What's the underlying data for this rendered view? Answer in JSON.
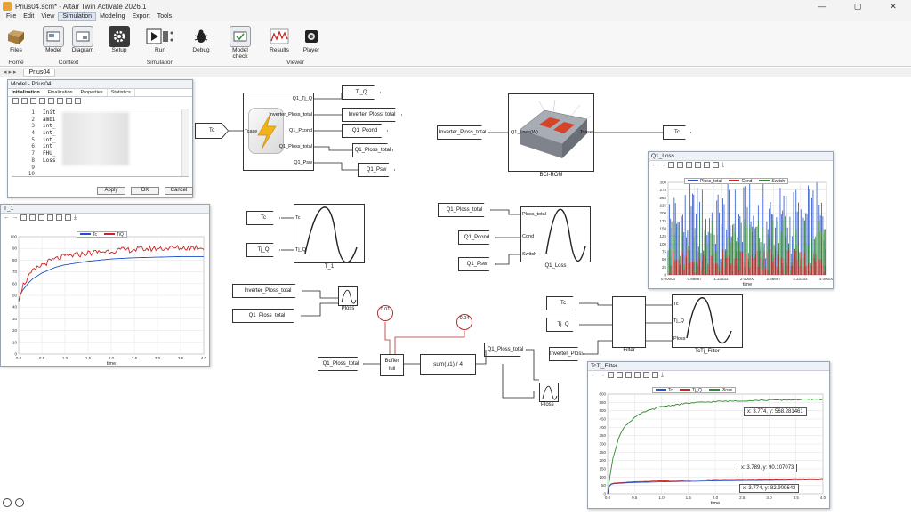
{
  "window": {
    "title": "Prius04.scm* - Altair Twin Activate 2026.1",
    "controls": [
      "—",
      "▢",
      "✕"
    ]
  },
  "menu": [
    "File",
    "Edit",
    "View",
    "Simulation",
    "Modeling",
    "Export",
    "Tools"
  ],
  "menu_active": "Simulation",
  "ribbon": {
    "buttons": {
      "files": "Files",
      "model": "Model",
      "diagram": "Diagram",
      "setup": "Setup",
      "run": "Run",
      "debug": "Debug",
      "model_check": "Model check",
      "results": "Results",
      "player": "Player"
    },
    "groups": {
      "home": "Home",
      "context": "Context",
      "simulation": "Simulation",
      "viewer": "Viewer"
    }
  },
  "breadcrumb": {
    "nav": "◂ ▸ ▸",
    "tab": "Prius04"
  },
  "model_dialog": {
    "title": "Model - Prius04",
    "tabs": [
      "Initialization",
      "Finalization",
      "Properties",
      "Statistics"
    ],
    "line_numbers": [
      "1",
      "2",
      "3",
      "4",
      "5",
      "6",
      "7",
      "8",
      "9",
      "10"
    ],
    "code": [
      "Init",
      "ambi",
      "int_",
      "int_",
      "int_",
      "int_",
      "FHU_",
      "Loss",
      "",
      ""
    ],
    "buttons": {
      "apply": "Apply",
      "ok": "OK",
      "cancel": "Cancel"
    }
  },
  "blocks": {
    "tc_in_1": "Tc",
    "tcase_port": "Tcase",
    "outs_1": {
      "tj_q": "Q1_Tj_Q",
      "inv_ploss": "Inverter_Ploss_total",
      "pcond": "Q1_Pcond",
      "ploss": "Q1_Ploss_total",
      "psw": "Q1_Psw"
    },
    "sigs_1": {
      "tj_q": "Tj_Q",
      "inv_ploss": "Inverter_Ploss_total",
      "pcond": "Q1_Pcond",
      "ploss": "Q1_Ploss_total",
      "psw": "Q1_Psw"
    },
    "bci": {
      "label": "BCI-ROM",
      "in_sig": "Inverter_Ploss_total",
      "in_port": "Q1_Loss(W)",
      "out_port": "Tcase",
      "out_sig": "Tc"
    },
    "t1": {
      "in_tc": "Tc",
      "in_tjq": "Tj_Q",
      "port_tc": "Tc",
      "port_tjq": "Tj_Q",
      "label": "T_1"
    },
    "q1loss": {
      "in_ploss": "Q1_Ploss_total",
      "in_pcond": "Q1_Pcond",
      "in_psw": "Q1_Psw",
      "port_ploss": "Ploss_total",
      "port_cond": "Cond",
      "port_switch": "Switch",
      "label": "Q1_Loss"
    },
    "ploss_scope": {
      "in_inv": "Inverter_Ploss_total",
      "in_q1": "Q1_Ploss_total",
      "label": "Ploss"
    },
    "const1": "0.01",
    "const2": "0.04",
    "buffer": {
      "in": "Q1_Ploss_total",
      "label": "Buffer",
      "sub": "full"
    },
    "sum": "sum(u1) / 4",
    "avg": {
      "sig": "Q1_Ploss_total",
      "label": "Ploss_"
    },
    "filter": {
      "in_tc": "Tc",
      "in_tjq": "Tj_Q",
      "in_inv": "Inverter_Ploss",
      "label": "Filter"
    },
    "tctj": {
      "port_tc": "Tc",
      "port_tjq": "Tj_Q",
      "port_ploss": "Ploss",
      "label": "TcTj_Filter"
    }
  },
  "panels": {
    "t1": {
      "title": "T_1",
      "legend": [
        "Tc",
        "TiQ"
      ],
      "colors": [
        "#1f4fc9",
        "#cc2222"
      ],
      "xlabel": "time"
    },
    "q1loss": {
      "title": "Q1_Loss",
      "legend": [
        "Ploss_total",
        "Cond",
        "Switch"
      ],
      "colors": [
        "#2a52c8",
        "#cc2222",
        "#2e8b2e"
      ],
      "xlabel": "time"
    },
    "tctj": {
      "title": "TcTj_Filter",
      "legend": [
        "Tc",
        "Tj_Q",
        "Ploss"
      ],
      "colors": [
        "#2a52c8",
        "#cc2222",
        "#2e8b2e"
      ],
      "xlabel": "time",
      "tooltips": [
        "x: 3.774,  y: 568.281461",
        "x: 3.789,  y: 90.107073",
        "x: 3.774,  y: 82.909643"
      ]
    }
  },
  "chart_data": [
    {
      "type": "line",
      "x_ticks": [
        "0.0",
        "0.5",
        "1.0",
        "1.5",
        "2.0",
        "2.5",
        "3.0",
        "3.5",
        "4.0"
      ],
      "y_ticks": [
        "0",
        "10",
        "20",
        "30",
        "40",
        "50",
        "60",
        "70",
        "80",
        "90",
        "100"
      ],
      "xlim": [
        0,
        4
      ],
      "ylim": [
        0,
        100
      ],
      "xlabel": "time",
      "series": [
        {
          "name": "Tc",
          "x": [
            0,
            0.05,
            0.1,
            0.2,
            0.3,
            0.5,
            0.8,
            1.0,
            1.5,
            2.0,
            2.5,
            3.0,
            3.5,
            4.0
          ],
          "values": [
            46,
            52,
            55,
            60,
            64,
            69,
            74,
            76,
            79,
            81,
            82,
            82.5,
            83,
            83
          ]
        },
        {
          "name": "TiQ",
          "x": [
            0,
            0.05,
            0.1,
            0.2,
            0.3,
            0.5,
            0.8,
            1.0,
            1.5,
            2.0,
            2.5,
            3.0,
            3.5,
            4.0
          ],
          "values": [
            47,
            54,
            59,
            65,
            70,
            76,
            81,
            83,
            86,
            88,
            89,
            90,
            90.5,
            91
          ]
        }
      ],
      "grid": true,
      "legend": "top-center"
    },
    {
      "type": "line",
      "x_ticks": [
        "0.00000",
        "0.66667",
        "1.33333",
        "2.00000",
        "2.66667",
        "3.33333",
        "4.00000"
      ],
      "y_ticks": [
        "0",
        "25",
        "50",
        "75",
        "100",
        "125",
        "150",
        "175",
        "200",
        "225",
        "250",
        "275",
        "300"
      ],
      "xlim": [
        0,
        4
      ],
      "ylim": [
        0,
        300
      ],
      "xlabel": "time",
      "series": [
        {
          "name": "Ploss_total",
          "range": [
            30,
            300
          ]
        },
        {
          "name": "Cond",
          "range": [
            0,
            85
          ]
        },
        {
          "name": "Switch",
          "range": [
            10,
            190
          ]
        }
      ],
      "grid": true,
      "legend": "top-center"
    },
    {
      "type": "line",
      "x_ticks": [
        "0.0",
        "0.5",
        "1.0",
        "1.5",
        "2.0",
        "2.5",
        "3.0",
        "3.5",
        "4.0"
      ],
      "y_ticks": [
        "0",
        "50",
        "100",
        "150",
        "200",
        "250",
        "300",
        "350",
        "400",
        "450",
        "500",
        "550",
        "600"
      ],
      "xlim": [
        0,
        4
      ],
      "ylim": [
        0,
        600
      ],
      "xlabel": "time",
      "series": [
        {
          "name": "Tc",
          "x": [
            0,
            0.02,
            0.05,
            0.1,
            0.3,
            0.5,
            1.0,
            1.5,
            2.0,
            3.0,
            4.0
          ],
          "values": [
            0,
            40,
            55,
            60,
            65,
            68,
            72,
            75,
            78,
            81,
            83
          ]
        },
        {
          "name": "Tj_Q",
          "x": [
            0,
            0.02,
            0.05,
            0.1,
            0.3,
            0.5,
            1.0,
            1.5,
            2.0,
            3.0,
            4.0
          ],
          "values": [
            0,
            42,
            58,
            63,
            68,
            72,
            78,
            82,
            85,
            88,
            90
          ]
        },
        {
          "name": "Ploss",
          "x": [
            0,
            0.05,
            0.1,
            0.2,
            0.3,
            0.5,
            0.7,
            1.0,
            1.5,
            2.0,
            2.5,
            3.0,
            3.5,
            3.774,
            4.0
          ],
          "values": [
            0,
            120,
            220,
            330,
            400,
            460,
            495,
            525,
            545,
            555,
            560,
            564,
            566,
            568.28,
            569
          ]
        }
      ],
      "grid": true,
      "legend": "top-center"
    }
  ]
}
